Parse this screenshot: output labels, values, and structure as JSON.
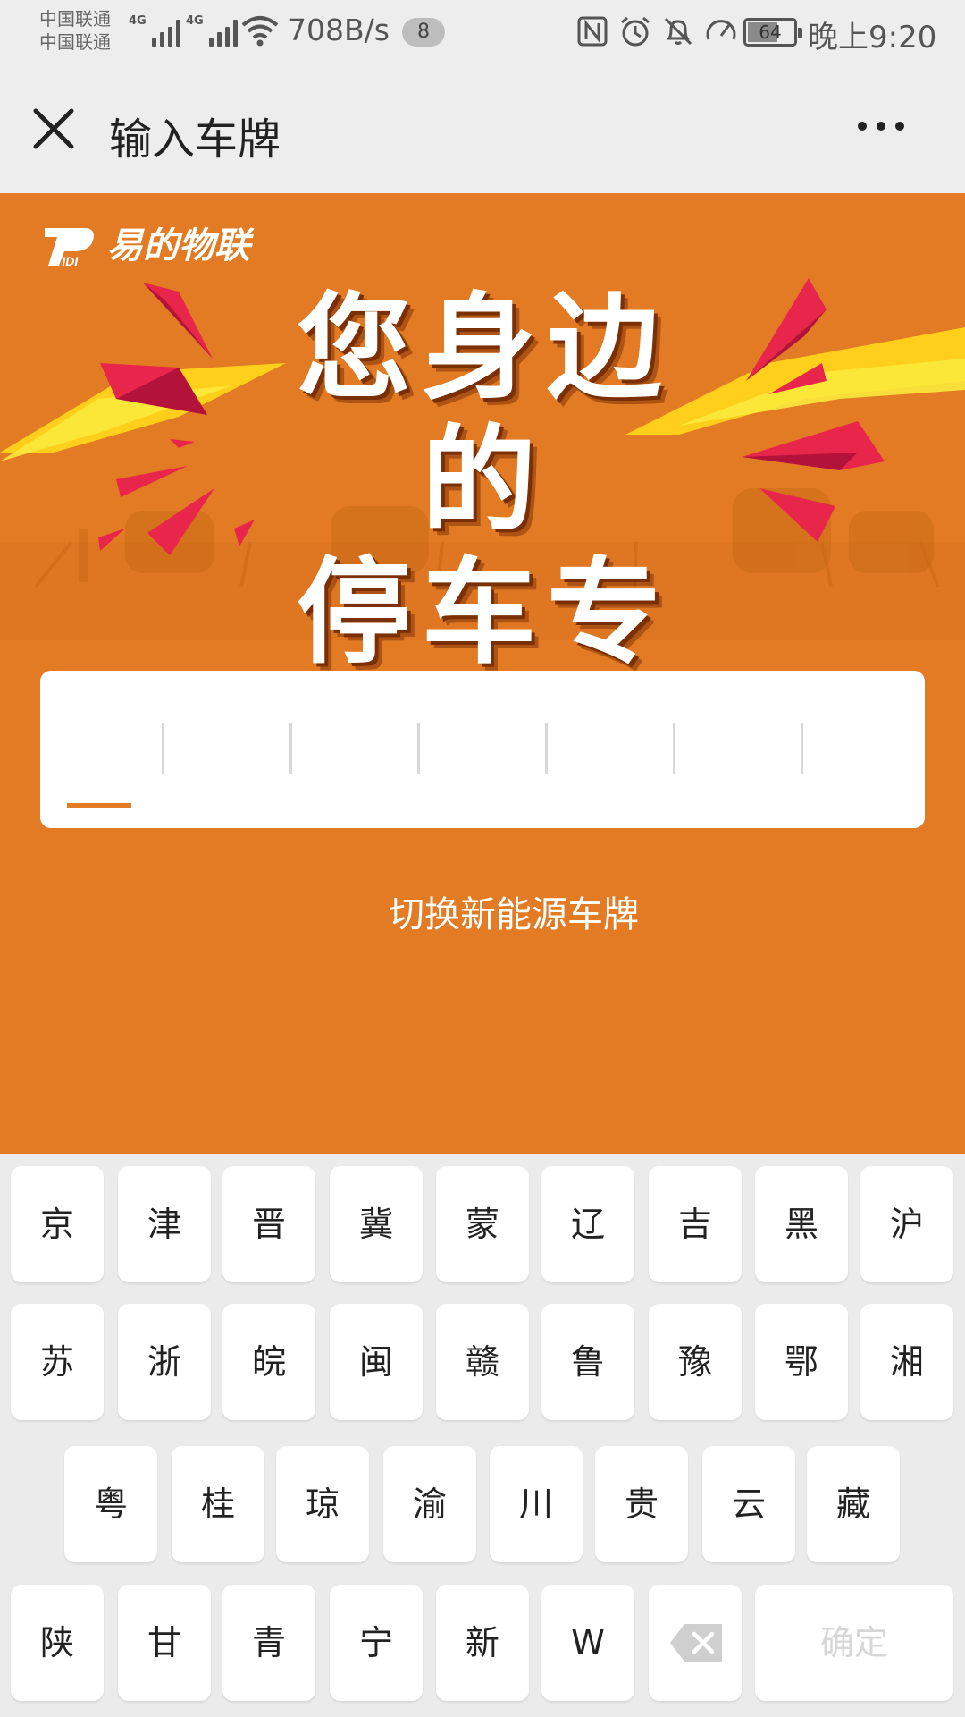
{
  "status_bar": {
    "carrier1": "中国联通",
    "carrier2": "中国联通",
    "network1": "4G",
    "network2": "4G",
    "speed": "708B/s",
    "notification_count": "8",
    "battery": "64",
    "time": "晚上9:20",
    "icons": [
      "nfc-icon",
      "alarm-icon",
      "bell-muted-icon",
      "speedometer-icon"
    ]
  },
  "header": {
    "title": "输入车牌",
    "close_icon": "close-icon",
    "more_icon": "more-horizontal-icon"
  },
  "banner": {
    "brand": "易的物联",
    "slogan_line1": "您身边的",
    "slogan_line2": "停车专家"
  },
  "plate_input": {
    "slots": 7,
    "active_slot": 1
  },
  "switch_link": "切换新能源车牌",
  "keyboard": {
    "row1": [
      "京",
      "津",
      "晋",
      "冀",
      "蒙",
      "辽",
      "吉",
      "黑",
      "沪"
    ],
    "row2": [
      "苏",
      "浙",
      "皖",
      "闽",
      "赣",
      "鲁",
      "豫",
      "鄂",
      "湘"
    ],
    "row3": [
      "粤",
      "桂",
      "琼",
      "渝",
      "川",
      "贵",
      "云",
      "藏"
    ],
    "row4": [
      "陕",
      "甘",
      "青",
      "宁",
      "新",
      "W"
    ],
    "delete_icon": "backspace-icon",
    "confirm_label": "确定"
  },
  "colors": {
    "accent": "#e27b23",
    "key_bg": "#ffffff",
    "keyboard_bg": "#ebebeb"
  }
}
